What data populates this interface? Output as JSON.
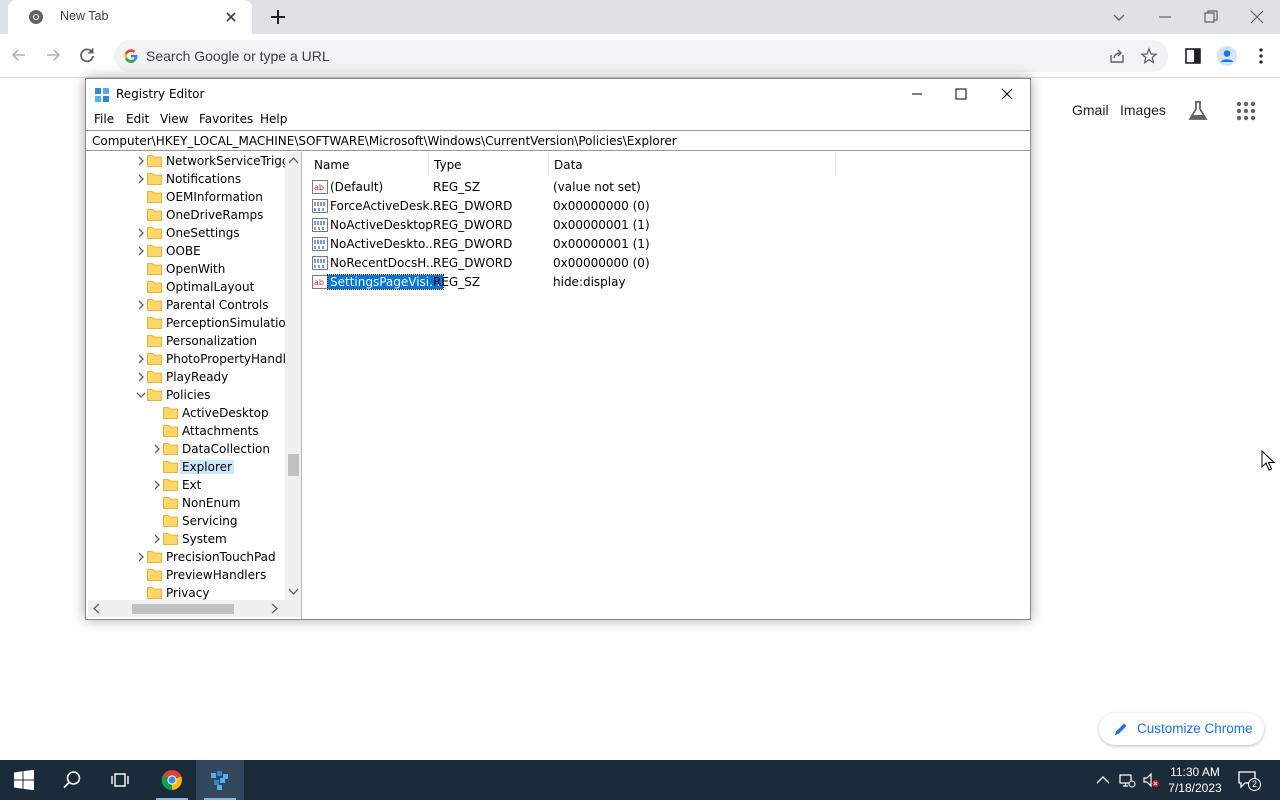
{
  "browser": {
    "tab_title": "New Tab",
    "omnibox_placeholder": "Search Google or type a URL",
    "ntp_links": [
      "Gmail",
      "Images"
    ],
    "customize_label": "Customize Chrome"
  },
  "regedit": {
    "title": "Registry Editor",
    "menu": [
      "File",
      "Edit",
      "View",
      "Favorites",
      "Help"
    ],
    "address": "Computer\\HKEY_LOCAL_MACHINE\\SOFTWARE\\Microsoft\\Windows\\CurrentVersion\\Policies\\Explorer",
    "tree": [
      {
        "label": "NetworkServiceTrigge",
        "expander": "collapsed"
      },
      {
        "label": "Notifications",
        "expander": "collapsed"
      },
      {
        "label": "OEMInformation",
        "expander": "none"
      },
      {
        "label": "OneDriveRamps",
        "expander": "none"
      },
      {
        "label": "OneSettings",
        "expander": "collapsed"
      },
      {
        "label": "OOBE",
        "expander": "collapsed"
      },
      {
        "label": "OpenWith",
        "expander": "none"
      },
      {
        "label": "OptimalLayout",
        "expander": "none"
      },
      {
        "label": "Parental Controls",
        "expander": "collapsed"
      },
      {
        "label": "PerceptionSimulation",
        "expander": "none"
      },
      {
        "label": "Personalization",
        "expander": "none"
      },
      {
        "label": "PhotoPropertyHandle",
        "expander": "collapsed"
      },
      {
        "label": "PlayReady",
        "expander": "collapsed"
      },
      {
        "label": "Policies",
        "expander": "expanded"
      },
      {
        "label": "ActiveDesktop",
        "expander": "none",
        "child": true
      },
      {
        "label": "Attachments",
        "expander": "none",
        "child": true
      },
      {
        "label": "DataCollection",
        "expander": "collapsed",
        "child": true
      },
      {
        "label": "Explorer",
        "expander": "none",
        "child": true,
        "selected": true
      },
      {
        "label": "Ext",
        "expander": "collapsed",
        "child": true
      },
      {
        "label": "NonEnum",
        "expander": "none",
        "child": true
      },
      {
        "label": "Servicing",
        "expander": "none",
        "child": true
      },
      {
        "label": "System",
        "expander": "collapsed",
        "child": true
      },
      {
        "label": "PrecisionTouchPad",
        "expander": "collapsed"
      },
      {
        "label": "PreviewHandlers",
        "expander": "none"
      },
      {
        "label": "Privacy",
        "expander": "none"
      }
    ],
    "columns": [
      "Name",
      "Type",
      "Data"
    ],
    "values": [
      {
        "name": "(Default)",
        "type": "REG_SZ",
        "data": "(value not set)",
        "kind": "string"
      },
      {
        "name": "ForceActiveDesk...",
        "type": "REG_DWORD",
        "data": "0x00000000 (0)",
        "kind": "binary"
      },
      {
        "name": "NoActiveDesktop",
        "type": "REG_DWORD",
        "data": "0x00000001 (1)",
        "kind": "binary"
      },
      {
        "name": "NoActiveDeskto...",
        "type": "REG_DWORD",
        "data": "0x00000001 (1)",
        "kind": "binary"
      },
      {
        "name": "NoRecentDocsH...",
        "type": "REG_DWORD",
        "data": "0x00000000 (0)",
        "kind": "binary"
      },
      {
        "name": "SettingsPageVisi...",
        "type": "REG_SZ",
        "data": "hide:display",
        "kind": "string",
        "selected": true
      }
    ]
  },
  "taskbar": {
    "time": "11:30 AM",
    "date": "7/18/2023",
    "notification_count": "2"
  }
}
